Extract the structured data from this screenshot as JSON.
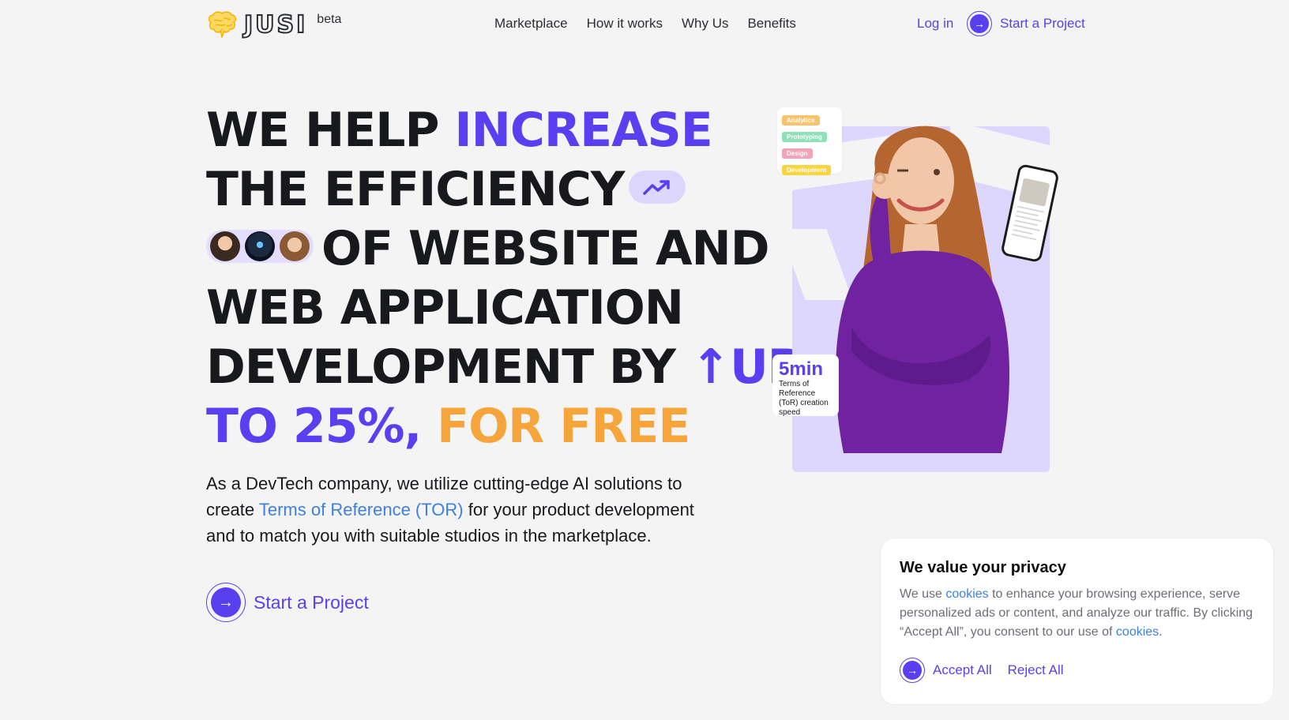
{
  "header": {
    "logo_text": "JUSI",
    "beta": "beta",
    "nav": [
      "Marketplace",
      "How it works",
      "Why Us",
      "Benefits"
    ],
    "login": "Log in",
    "cta": "Start a Project"
  },
  "hero": {
    "title": {
      "l1a": "WE HELP ",
      "l1b": "INCREASE",
      "l2": "THE EFFICIENCY",
      "l3": "OF WEBSITE AND",
      "l4": "WEB APPLICATION",
      "l5a": "DEVELOPMENT BY ",
      "l5b": "↑UP",
      "l6a": "TO 25%",
      "l6b": ", ",
      "l6c": "FOR FREE"
    },
    "desc_a": "As a DevTech company, we utilize cutting-edge AI solutions to create ",
    "desc_link": "Terms of Reference (TOR)",
    "desc_b": " for your product development and to match you with suitable studios in the marketplace.",
    "cta": "Start a Project"
  },
  "visual": {
    "tags": [
      "Analytics",
      "Prototyping",
      "Design",
      "Development"
    ],
    "stat_value": "5min",
    "stat_label": "Terms of Reference (ToR) creation speed"
  },
  "cookie": {
    "title": "We value your privacy",
    "text_a": "We use ",
    "link1": "cookies",
    "text_b": " to enhance your browsing experience, serve personalized ads or content, and analyze our traffic. By clicking “Accept All”, you consent to our use of ",
    "link2": "cookies",
    "text_c": ".",
    "accept": "Accept All",
    "reject": "Reject All"
  },
  "colors": {
    "accent": "#5a3ff0",
    "orange": "#f6a53a",
    "link": "#3e7fe0",
    "lavender": "#ddd6fd"
  }
}
